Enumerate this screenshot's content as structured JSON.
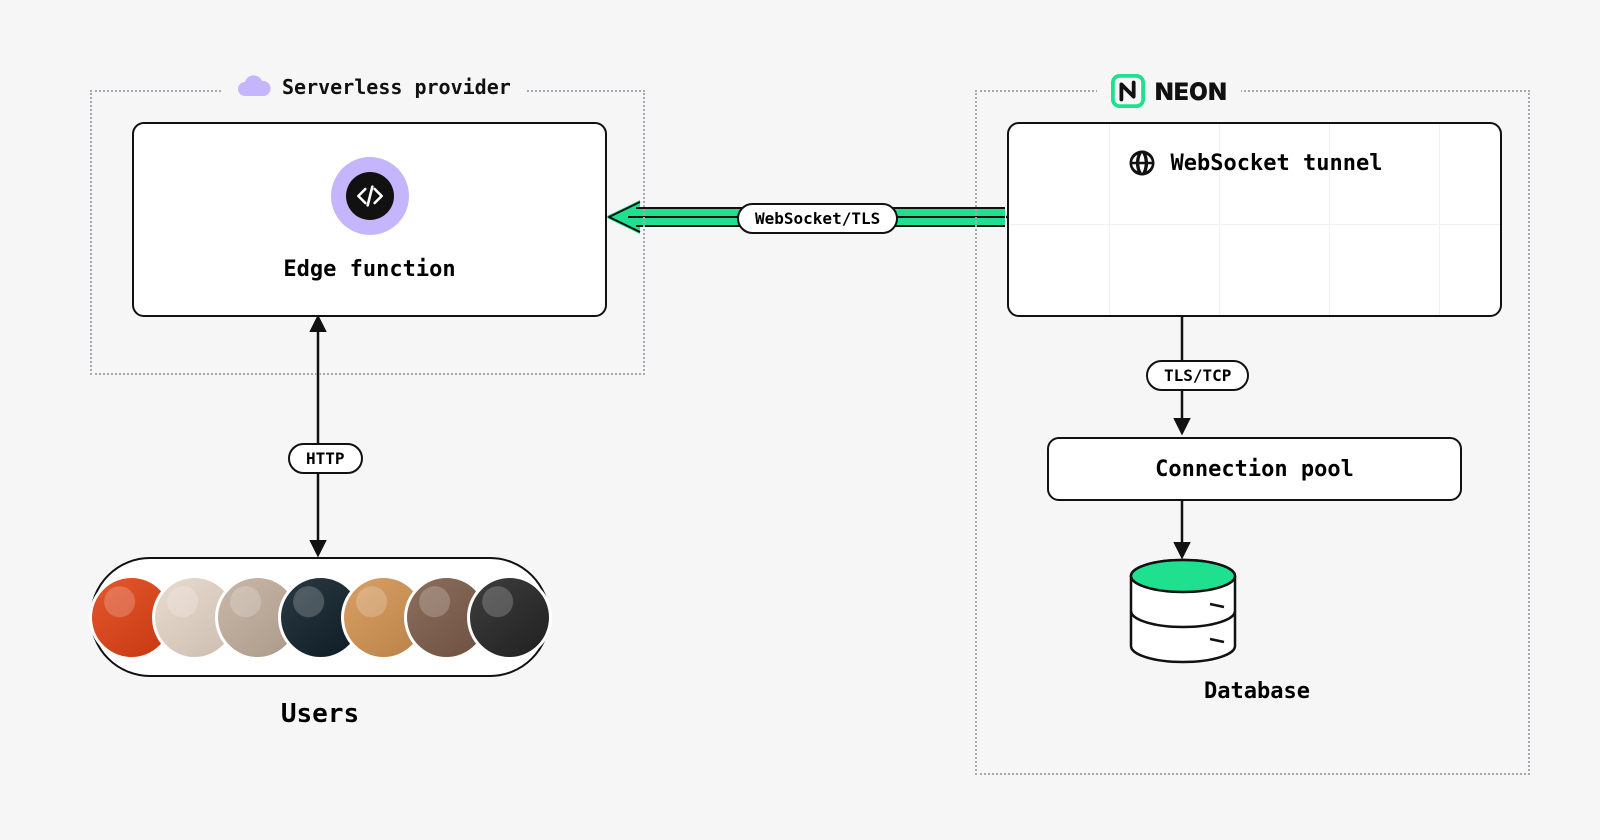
{
  "serverless": {
    "title": "Serverless provider",
    "edge_label": "Edge function"
  },
  "neon": {
    "brand": "NEON",
    "ws_label": "WebSocket tunnel",
    "pool_label": "Connection pool",
    "db_label": "Database"
  },
  "users": {
    "label": "Users"
  },
  "protocols": {
    "http": "HTTP",
    "ws": "WebSocket/TLS",
    "tcp": "TLS/TCP"
  },
  "colors": {
    "accent_green": "#1FE08F",
    "accent_purple": "#C4B5FD",
    "ink": "#111111",
    "bg": "#F6F6F7"
  },
  "avatars": [
    {
      "bg": "#E4572E"
    },
    {
      "bg": "#EADBCF"
    },
    {
      "bg": "#C9B8A8"
    },
    {
      "bg": "#2B3A42"
    },
    {
      "bg": "#D9A066"
    },
    {
      "bg": "#8C6E5D"
    },
    {
      "bg": "#3E3E3E"
    }
  ]
}
